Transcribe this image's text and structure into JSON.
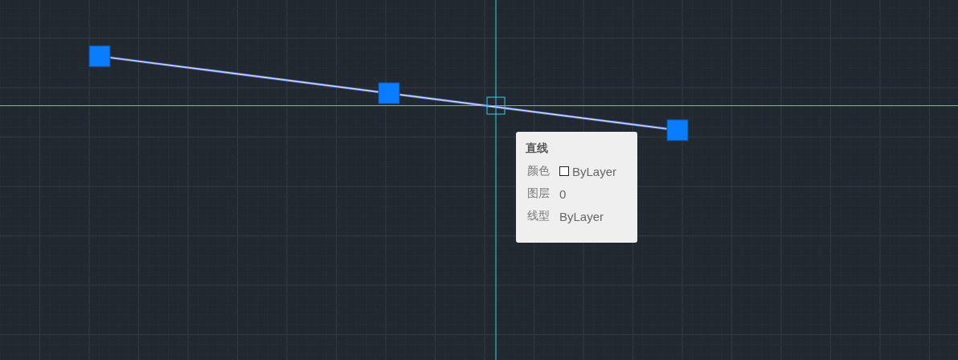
{
  "tooltip": {
    "title": "直线",
    "properties": [
      {
        "label": "颜色",
        "value": "ByLayer",
        "kind": "color"
      },
      {
        "label": "图层",
        "value": "0",
        "kind": "text"
      },
      {
        "label": "线型",
        "value": "ByLayer",
        "kind": "text"
      }
    ]
  }
}
